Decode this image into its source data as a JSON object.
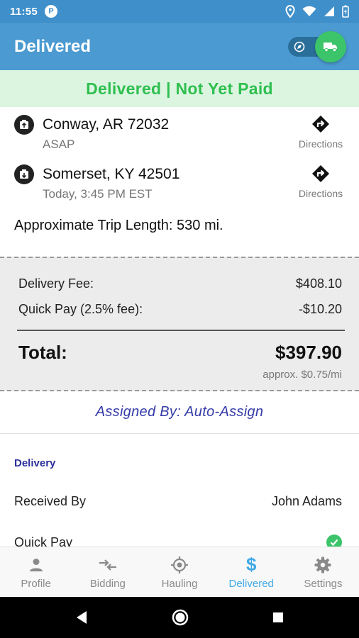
{
  "status_bar": {
    "time": "11:55",
    "app_badge": "P"
  },
  "app_bar": {
    "title": "Delivered"
  },
  "banner": {
    "text": "Delivered | Not Yet Paid"
  },
  "stops": [
    {
      "city": "Conway, AR 72032",
      "when": "ASAP",
      "directions_label": "Directions"
    },
    {
      "city": "Somerset, KY 42501",
      "when": "Today, 3:45 PM EST",
      "directions_label": "Directions"
    }
  ],
  "trip": {
    "text": "Approximate Trip Length: 530 mi."
  },
  "fees": {
    "delivery_fee_label": "Delivery Fee:",
    "delivery_fee_value": "$408.10",
    "quick_pay_label": "Quick Pay (2.5% fee):",
    "quick_pay_value": "-$10.20",
    "total_label": "Total:",
    "total_value": "$397.90",
    "approx": "approx. $0.75/mi"
  },
  "assigned": {
    "text": "Assigned By: Auto-Assign"
  },
  "delivery": {
    "section_title": "Delivery",
    "received_by_label": "Received By",
    "received_by_value": "John Adams",
    "quick_pay_label": "Quick Pay",
    "quick_pay_checked": true
  },
  "bottom_nav": [
    {
      "label": "Profile",
      "icon": "person-icon",
      "active": false
    },
    {
      "label": "Bidding",
      "icon": "swap-arrows-icon",
      "active": false
    },
    {
      "label": "Hauling",
      "icon": "gps-target-icon",
      "active": false
    },
    {
      "label": "Delivered",
      "icon": "dollar-icon",
      "active": true
    },
    {
      "label": "Settings",
      "icon": "gear-icon",
      "active": false
    }
  ],
  "colors": {
    "app_bar": "#4b9ad1",
    "status_bar": "#3f8fca",
    "banner_bg": "#dcf5e1",
    "banner_text": "#2fbf4f",
    "accent_active": "#3fa9e6",
    "assigned_text": "#343aa8",
    "toggle_on": "#3cc46a"
  }
}
